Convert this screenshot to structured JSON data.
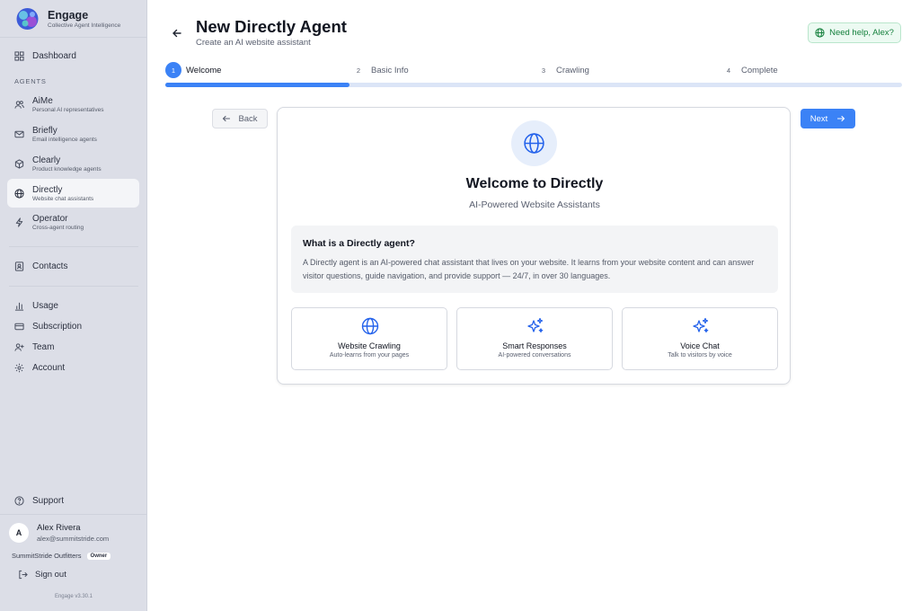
{
  "brand": {
    "name": "Engage",
    "tagline": "Collective Agent Intelligence"
  },
  "sidebar": {
    "dashboard": "Dashboard",
    "section_agents": "AGENTS",
    "agents": [
      {
        "label": "AiMe",
        "sub": "Personal AI representatives",
        "icon": "users-icon"
      },
      {
        "label": "Briefly",
        "sub": "Email intelligence agents",
        "icon": "mail-icon"
      },
      {
        "label": "Clearly",
        "sub": "Product knowledge agents",
        "icon": "box-icon"
      },
      {
        "label": "Directly",
        "sub": "Website chat assistants",
        "icon": "globe-icon",
        "active": true
      },
      {
        "label": "Operator",
        "sub": "Cross-agent routing",
        "icon": "lightning-icon"
      }
    ],
    "contacts": "Contacts",
    "usage": "Usage",
    "subscription": "Subscription",
    "team": "Team",
    "account": "Account",
    "support": "Support",
    "user": {
      "initial": "A",
      "name": "Alex Rivera",
      "email": "alex@summitstride.com"
    },
    "org": {
      "name": "SummitStride Outfitters",
      "role": "Owner"
    },
    "sign_out": "Sign out",
    "version": "Engage v3.30.1"
  },
  "header": {
    "title": "New Directly Agent",
    "subtitle": "Create an AI website assistant",
    "help_label": "Need help, Alex?"
  },
  "stepper": {
    "steps": [
      {
        "num": "1",
        "label": "Welcome"
      },
      {
        "num": "2",
        "label": "Basic Info"
      },
      {
        "num": "3",
        "label": "Crawling"
      },
      {
        "num": "4",
        "label": "Complete"
      }
    ],
    "current_step": 1,
    "progress": 0.25
  },
  "nav_buttons": {
    "back": "Back",
    "next": "Next"
  },
  "card": {
    "title": "Welcome to Directly",
    "subtitle": "AI-Powered Website Assistants",
    "info_title": "What is a Directly agent?",
    "info_body": "A Directly agent is an AI-powered chat assistant that lives on your website. It learns from your website content and can answer visitor questions, guide navigation, and provide support — 24/7, in over 30 languages.",
    "features": [
      {
        "title": "Website Crawling",
        "sub": "Auto-learns from your pages",
        "icon": "globe-icon"
      },
      {
        "title": "Smart Responses",
        "sub": "AI-powered conversations",
        "icon": "sparkles-icon"
      },
      {
        "title": "Voice Chat",
        "sub": "Talk to visitors by voice",
        "icon": "sparkles-icon"
      }
    ]
  },
  "colors": {
    "accent": "#3b82f6",
    "sidebar_bg": "#dcdee7",
    "help_green": "#15803d"
  }
}
